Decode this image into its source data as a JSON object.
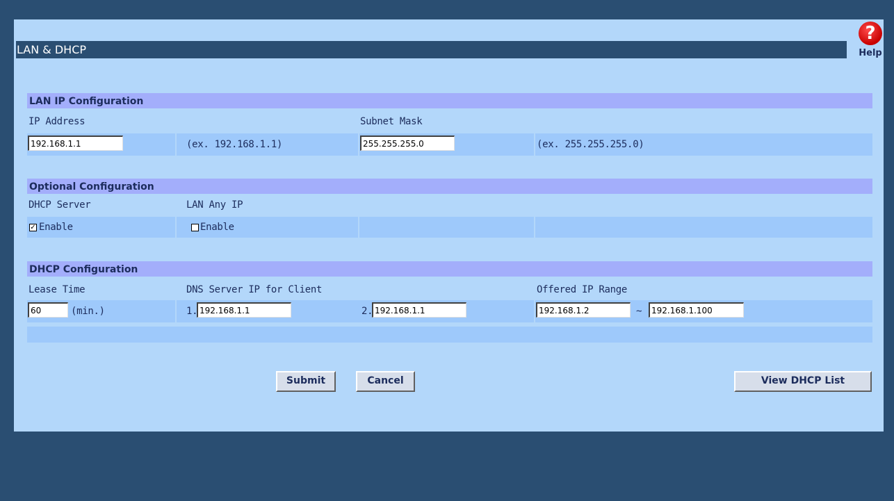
{
  "page": {
    "title": "LAN & DHCP"
  },
  "help": {
    "glyph": "?",
    "label": "Help",
    "icon": "help-icon"
  },
  "lan_ip": {
    "section_title": "LAN IP Configuration",
    "ip_label": "IP Address",
    "ip_value": "192.168.1.1",
    "ip_example": "(ex. 192.168.1.1)",
    "mask_label": "Subnet Mask",
    "mask_value": "255.255.255.0",
    "mask_example": "(ex. 255.255.255.0)"
  },
  "optional": {
    "section_title": "Optional Configuration",
    "dhcp_server_label": "DHCP Server",
    "dhcp_server_checked": true,
    "dhcp_server_enable_label": "Enable",
    "lan_any_ip_label": "LAN Any IP",
    "lan_any_ip_checked": false,
    "lan_any_ip_enable_label": "Enable"
  },
  "dhcp": {
    "section_title": "DHCP Configuration",
    "lease_label": "Lease Time",
    "lease_value": "60",
    "lease_unit": "(min.)",
    "dns_label": "DNS Server IP for Client",
    "dns1_prefix": "1.",
    "dns1_value": "192.168.1.1",
    "dns2_prefix": "2.",
    "dns2_value": "192.168.1.1",
    "range_label": "Offered IP Range",
    "range_start": "192.168.1.2",
    "range_sep": "~",
    "range_end": "192.168.1.100"
  },
  "buttons": {
    "submit": "Submit",
    "cancel": "Cancel",
    "view_list": "View DHCP List"
  },
  "colors": {
    "background": "#2a4e72",
    "panel": "#b3d7fa",
    "section_header": "#a3aefb",
    "row": "#9ec9fb",
    "text": "#1c2c5c",
    "help_red": "#c80000"
  }
}
